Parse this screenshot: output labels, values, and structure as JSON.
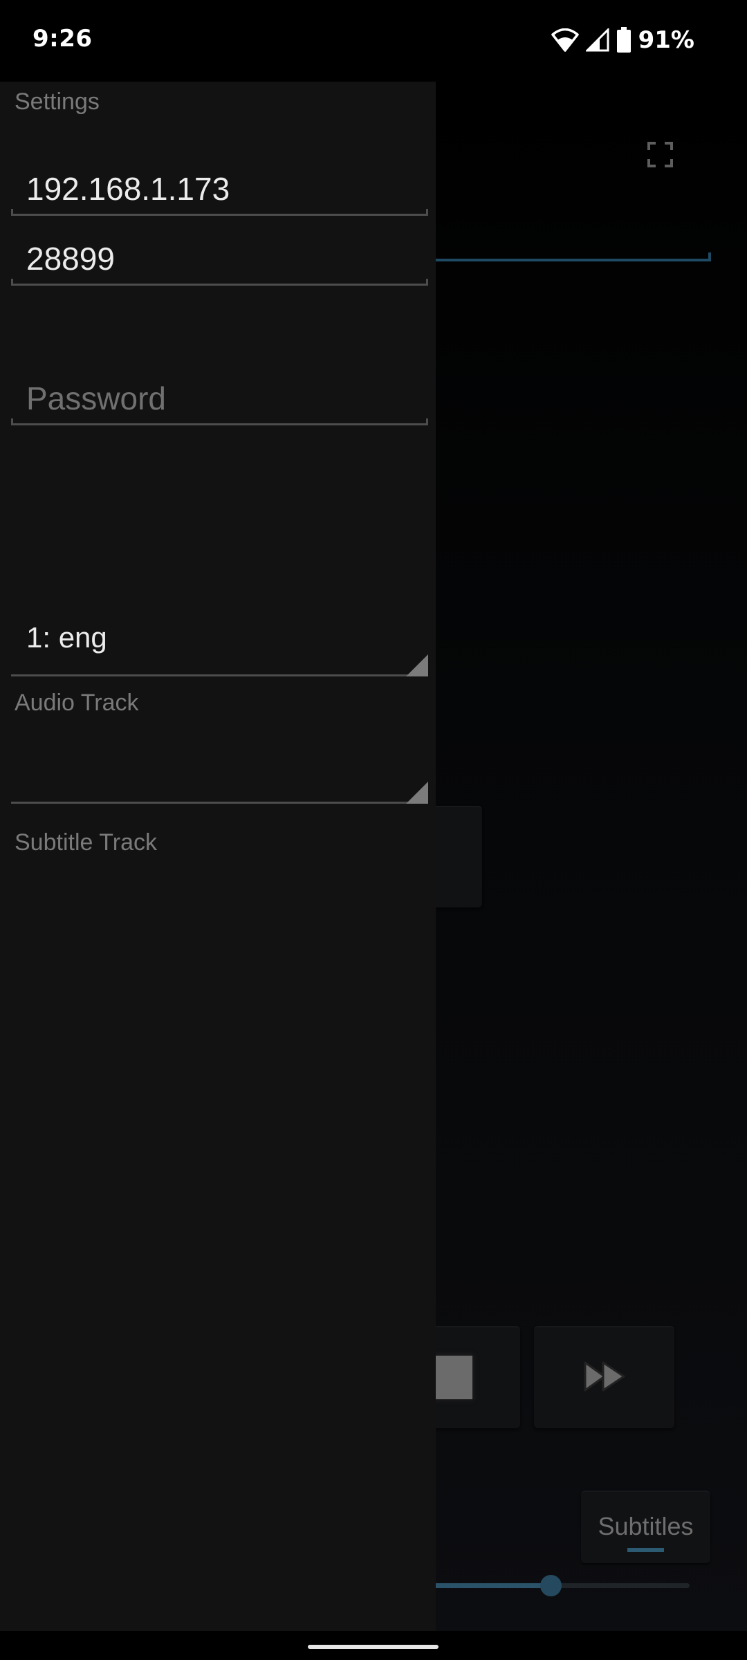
{
  "status_bar": {
    "time": "9:26",
    "battery_percent": "91%",
    "icons": [
      "wifi-icon",
      "cellular-signal-icon",
      "battery-icon"
    ]
  },
  "background_app": {
    "fullscreen_icon": "fullscreen-icon",
    "accent_color": "#2d5a73",
    "controls": {
      "stop_icon": "stop-icon",
      "fast_forward_icon": "fast-forward-icon",
      "subtitles_label": "Subtitles"
    },
    "seekbar_progress": 0.54
  },
  "drawer": {
    "title": "Settings",
    "host": {
      "value": "192.168.1.173",
      "placeholder": ""
    },
    "port": {
      "value": "28899",
      "placeholder": ""
    },
    "password": {
      "value": "",
      "placeholder": "Password"
    },
    "audio_track": {
      "selected": "1: eng",
      "label": "Audio Track"
    },
    "subtitle_track": {
      "selected": "",
      "label": "Subtitle Track"
    }
  }
}
